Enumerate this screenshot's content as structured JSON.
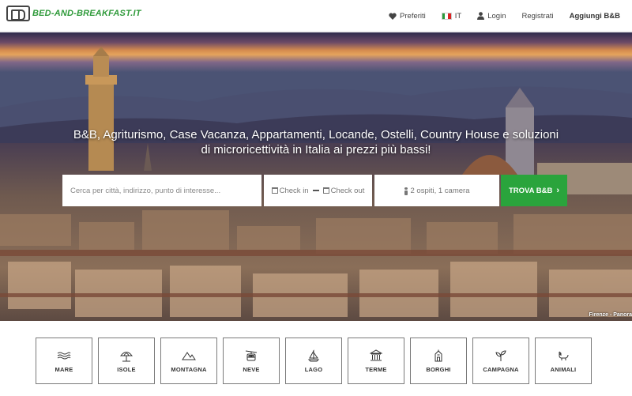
{
  "header": {
    "logo_text": "BED-AND-BREAKFAST.IT",
    "nav": {
      "favorites": "Preferiti",
      "language": "IT",
      "login": "Login",
      "register": "Registrati",
      "add_bnb": "Aggiungi B&B"
    }
  },
  "hero": {
    "title": "B&B, Agriturismo, Case Vacanza, Appartamenti, Locande, Ostelli, Country House e soluzioni di microricettività in Italia ai prezzi più bassi!",
    "caption": "Firenze - Panora"
  },
  "search": {
    "where_placeholder": "Cerca per città, indirizzo, punto di interesse...",
    "checkin": "Check in",
    "checkout": "Check out",
    "guests": "2 ospiti, 1 camera",
    "find_button": "TROVA B&B"
  },
  "categories": [
    {
      "label": "MARE",
      "icon": "waves-icon"
    },
    {
      "label": "ISOLE",
      "icon": "beach-umbrella-icon"
    },
    {
      "label": "MONTAGNA",
      "icon": "mountain-icon"
    },
    {
      "label": "NEVE",
      "icon": "cable-car-icon"
    },
    {
      "label": "LAGO",
      "icon": "sailboat-icon"
    },
    {
      "label": "TERME",
      "icon": "temple-icon"
    },
    {
      "label": "BORGHI",
      "icon": "village-icon"
    },
    {
      "label": "CAMPAGNA",
      "icon": "sprout-icon"
    },
    {
      "label": "ANIMALI",
      "icon": "pet-icon"
    }
  ],
  "colors": {
    "brand_green": "#2aa43c",
    "logo_green": "#2f9a3a"
  }
}
